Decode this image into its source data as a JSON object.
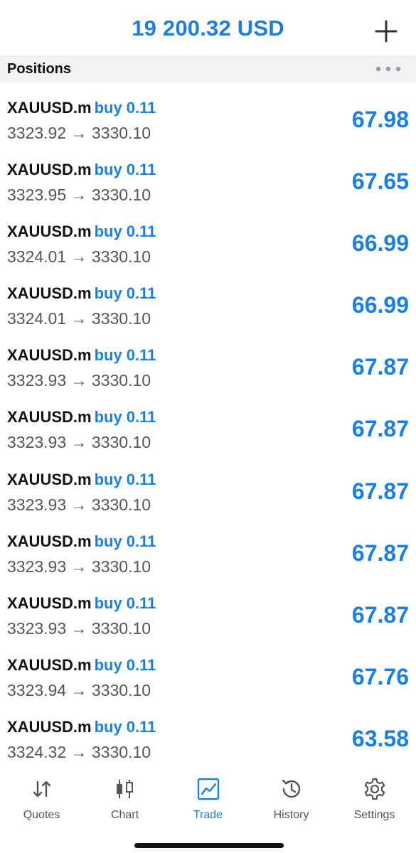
{
  "header": {
    "balance": "19 200.32 USD",
    "add_icon": "plus-icon"
  },
  "section": {
    "title": "Positions",
    "more_icon": "ellipsis-icon"
  },
  "positions": [
    {
      "symbol": "XAUUSD.m",
      "side": "buy 0.11",
      "prices": "3323.92 → 3330.10",
      "profit": "67.98"
    },
    {
      "symbol": "XAUUSD.m",
      "side": "buy 0.11",
      "prices": "3323.95 → 3330.10",
      "profit": "67.65"
    },
    {
      "symbol": "XAUUSD.m",
      "side": "buy 0.11",
      "prices": "3324.01 → 3330.10",
      "profit": "66.99"
    },
    {
      "symbol": "XAUUSD.m",
      "side": "buy 0.11",
      "prices": "3324.01 → 3330.10",
      "profit": "66.99"
    },
    {
      "symbol": "XAUUSD.m",
      "side": "buy 0.11",
      "prices": "3323.93 → 3330.10",
      "profit": "67.87"
    },
    {
      "symbol": "XAUUSD.m",
      "side": "buy 0.11",
      "prices": "3323.93 → 3330.10",
      "profit": "67.87"
    },
    {
      "symbol": "XAUUSD.m",
      "side": "buy 0.11",
      "prices": "3323.93 → 3330.10",
      "profit": "67.87"
    },
    {
      "symbol": "XAUUSD.m",
      "side": "buy 0.11",
      "prices": "3323.93 → 3330.10",
      "profit": "67.87"
    },
    {
      "symbol": "XAUUSD.m",
      "side": "buy 0.11",
      "prices": "3323.93 → 3330.10",
      "profit": "67.87"
    },
    {
      "symbol": "XAUUSD.m",
      "side": "buy 0.11",
      "prices": "3323.94 → 3330.10",
      "profit": "67.76"
    },
    {
      "symbol": "XAUUSD.m",
      "side": "buy 0.11",
      "prices": "3324.32 → 3330.10",
      "profit": "63.58"
    }
  ],
  "tabs": [
    {
      "label": "Quotes",
      "icon": "quotes-arrows-icon"
    },
    {
      "label": "Chart",
      "icon": "candlestick-icon"
    },
    {
      "label": "Trade",
      "icon": "trade-chart-icon",
      "active": true
    },
    {
      "label": "History",
      "icon": "history-clock-icon"
    },
    {
      "label": "Settings",
      "icon": "gear-icon"
    }
  ],
  "colors": {
    "accent": "#1a7fe0",
    "text": "#111111",
    "secondary_text": "#555555",
    "header_bg": "#f2f2f5"
  }
}
